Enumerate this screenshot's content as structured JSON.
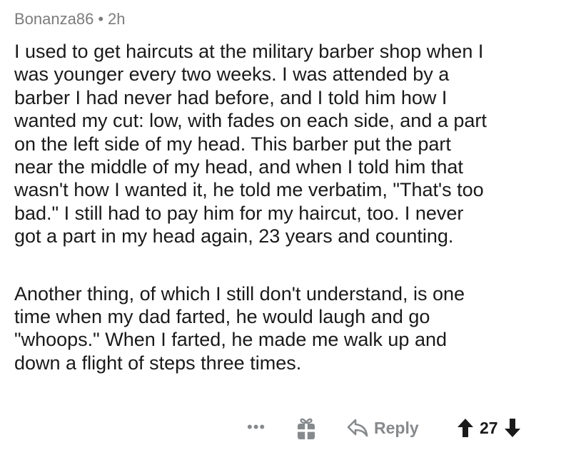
{
  "comment": {
    "author": "Bonanza86",
    "separator": "•",
    "age": "2h",
    "paragraphs": [
      "I used to get haircuts at the military barber shop when I\nwas younger every two weeks. I was attended by a\nbarber I had never had before, and I told him how I\nwanted my cut: low, with fades on each side, and a part\non the left side of my head. This barber put the part\nnear the middle of my head, and when I told him that\nwasn't how I wanted it, he told me verbatim, \"That's too\nbad.\" I still had to pay him for my haircut, too. I never\ngot a part in my head again, 23 years and counting.",
      "Another thing, of which I still don't understand, is one\ntime when my dad farted, he would laugh and go\n\"whoops.\" When I farted, he made me walk up and\ndown a flight of steps three times."
    ]
  },
  "actions": {
    "more_label": "•••",
    "award_icon": "gift-award-icon",
    "reply_icon": "reply-arrow-icon",
    "reply_label": "Reply",
    "upvote_icon": "upvote-arrow-icon",
    "score": "27",
    "downvote_icon": "downvote-arrow-icon"
  },
  "colors": {
    "text": "#1a1a1b",
    "meta": "#7c7c7c",
    "action": "#878a8c"
  }
}
